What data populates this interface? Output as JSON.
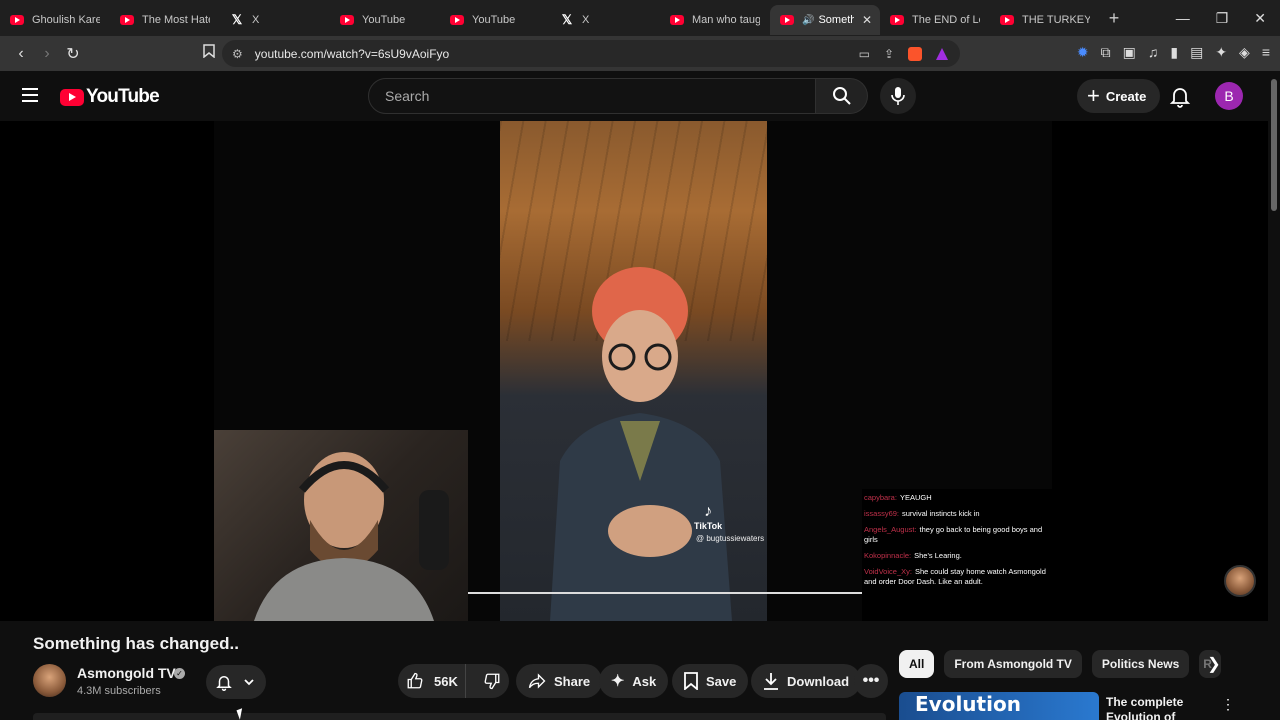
{
  "browser": {
    "tabs": [
      {
        "label": "Ghoulish Karen",
        "icon": "youtube-favicon",
        "active": false
      },
      {
        "label": "The Most Hated",
        "icon": "youtube-favicon",
        "active": false
      },
      {
        "label": "X",
        "icon": "x-favicon",
        "active": false
      },
      {
        "label": "YouTube",
        "icon": "youtube-favicon",
        "active": false
      },
      {
        "label": "YouTube",
        "icon": "youtube-favicon",
        "active": false
      },
      {
        "label": "X",
        "icon": "x-favicon",
        "active": false
      },
      {
        "label": "Man who taught",
        "icon": "youtube-favicon",
        "active": false
      },
      {
        "label": "Someth",
        "icon": "youtube-favicon",
        "active": true
      },
      {
        "label": "The END of Lol",
        "icon": "youtube-favicon",
        "active": false
      },
      {
        "label": "THE TURKEY TO",
        "icon": "youtube-favicon",
        "active": false
      }
    ],
    "url": "youtube.com/watch?v=6sU9vAoiFyo"
  },
  "masthead": {
    "logo_text": "YouTube",
    "search_placeholder": "Search",
    "create_label": "Create",
    "avatar_letter": "B",
    "avatar_color": "#9c27b0"
  },
  "player": {
    "tiktok_label": "TikTok",
    "tiktok_handle": "@ bugtussiewaters",
    "chat": [
      {
        "user": "capybara:",
        "text": "YEAUGH"
      },
      {
        "user": "issassy69:",
        "text": "survival instincts kick in"
      },
      {
        "user": "Angels_August:",
        "text": "they go back to being good boys and girls"
      },
      {
        "user": "Kokopinnacle:",
        "text": "She's Learing."
      },
      {
        "user": "VoidVoice_Xy:",
        "text": "She could stay home watch Asmongold and order Door Dash. Like an adult."
      }
    ]
  },
  "video": {
    "title": "Something has changed..",
    "channel_name": "Asmongold TV",
    "subscribers": "4.3M subscribers",
    "likes": "56K",
    "actions": {
      "share": "Share",
      "ask": "Ask",
      "save": "Save",
      "download": "Download"
    }
  },
  "sidebar": {
    "chips": [
      "All",
      "From Asmongold TV",
      "Politics News",
      "R"
    ],
    "recommendation": {
      "thumb_text": "Evolution",
      "title": "The complete Evolution of Halo's"
    }
  },
  "colors": {
    "youtube_red": "#ff0033",
    "background": "#0f0f0f",
    "chip_bg": "#272727"
  }
}
